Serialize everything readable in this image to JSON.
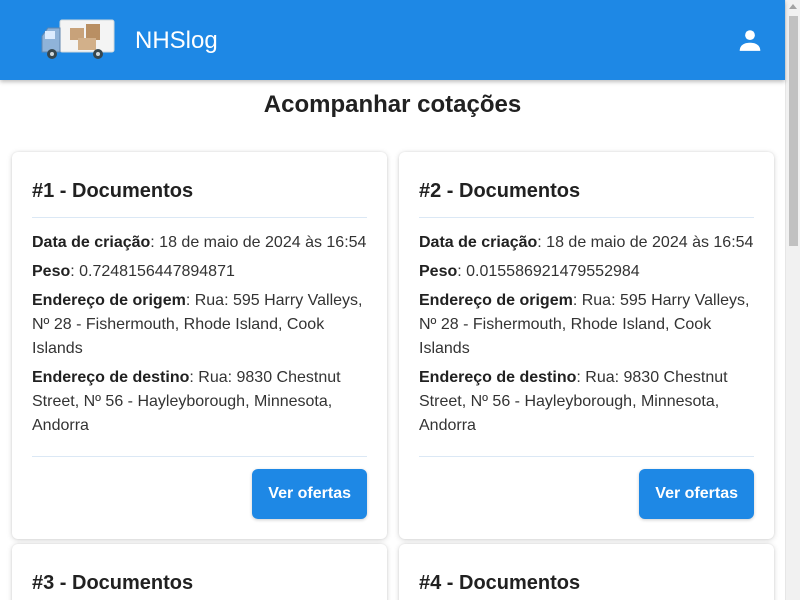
{
  "header": {
    "brand": "NHSlog",
    "logo_icon": "delivery-truck-icon",
    "account_icon": "account-icon",
    "color": "#1e88e5"
  },
  "page": {
    "title": "Acompanhar cotações"
  },
  "labels": {
    "created": "Data de criação",
    "weight": "Peso",
    "origin": "Endereço de origem",
    "destination": "Endereço de destino",
    "offers_button": "Ver ofertas"
  },
  "quotes": [
    {
      "title": "#1 - Documentos",
      "created": "18 de maio de 2024 às 16:54",
      "weight": "0.7248156447894871",
      "origin": "Rua: 595 Harry Valleys, Nº 28 - Fishermouth, Rhode Island, Cook Islands",
      "destination": "Rua: 9830 Chestnut Street, Nº 56 - Hayleyborough, Minnesota, Andorra"
    },
    {
      "title": "#2 - Documentos",
      "created": "18 de maio de 2024 às 16:54",
      "weight": "0.015586921479552984",
      "origin": "Rua: 595 Harry Valleys, Nº 28 - Fishermouth, Rhode Island, Cook Islands",
      "destination": "Rua: 9830 Chestnut Street, Nº 56 - Hayleyborough, Minnesota, Andorra"
    },
    {
      "title": "#3 - Documentos"
    },
    {
      "title": "#4 - Documentos"
    }
  ]
}
